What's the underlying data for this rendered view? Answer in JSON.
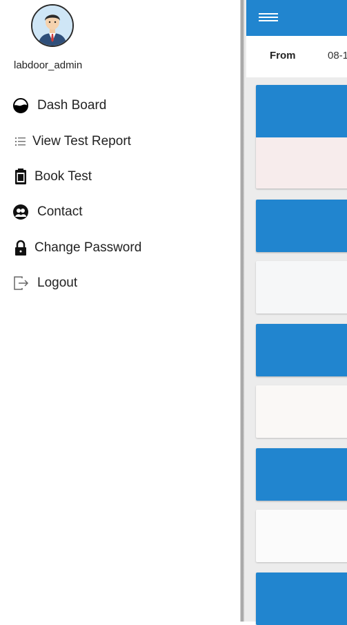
{
  "drawer": {
    "username": "labdoor_admin",
    "items": [
      {
        "label": "Dash Board",
        "icon": "dashboard-icon"
      },
      {
        "label": "View Test Report",
        "icon": "list-icon"
      },
      {
        "label": "Book Test",
        "icon": "clipboard-icon"
      },
      {
        "label": "Contact",
        "icon": "contacts-icon"
      },
      {
        "label": "Change Password",
        "icon": "lock-icon"
      },
      {
        "label": "Logout",
        "icon": "logout-icon"
      }
    ]
  },
  "main": {
    "filter": {
      "from_label": "From",
      "from_value": "08-1"
    }
  },
  "colors": {
    "accent": "#2185cf",
    "card_tint": "#f7ecec"
  }
}
